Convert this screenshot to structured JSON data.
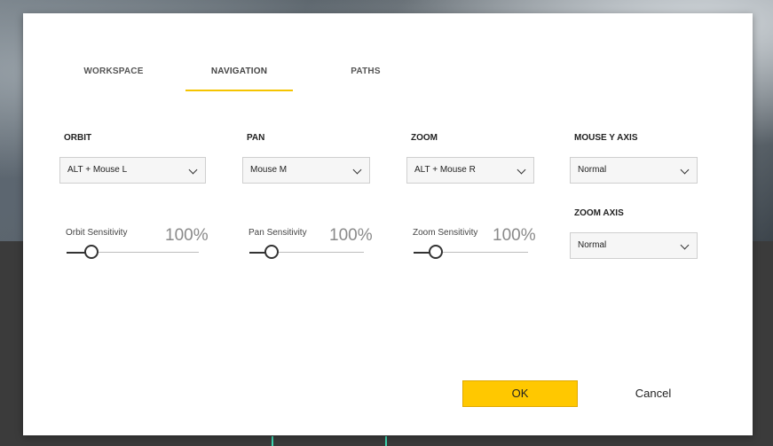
{
  "tabs": [
    {
      "label": "WORKSPACE",
      "active": false
    },
    {
      "label": "NAVIGATION",
      "active": true
    },
    {
      "label": "PATHS",
      "active": false
    }
  ],
  "orbit": {
    "label": "ORBIT",
    "select_value": "ALT + Mouse L",
    "sensitivity_label": "Orbit Sensitivity",
    "sensitivity_value": "100%",
    "slider_level": 0.19
  },
  "pan": {
    "label": "PAN",
    "select_value": "Mouse M",
    "sensitivity_label": "Pan Sensitivity",
    "sensitivity_value": "100%",
    "slider_level": 0.19
  },
  "zoom": {
    "label": "ZOOM",
    "select_value": "ALT + Mouse R",
    "sensitivity_label": "Zoom Sensitivity",
    "sensitivity_value": "100%",
    "slider_level": 0.19
  },
  "mouse_y_axis": {
    "label": "MOUSE Y AXIS",
    "select_value": "Normal"
  },
  "zoom_axis": {
    "label": "ZOOM AXIS",
    "select_value": "Normal"
  },
  "buttons": {
    "ok_label": "OK",
    "cancel_label": "Cancel"
  },
  "colors": {
    "accent": "#ffc800",
    "tab_underline": "#f5c400",
    "background_line": "#3fd6b0"
  }
}
